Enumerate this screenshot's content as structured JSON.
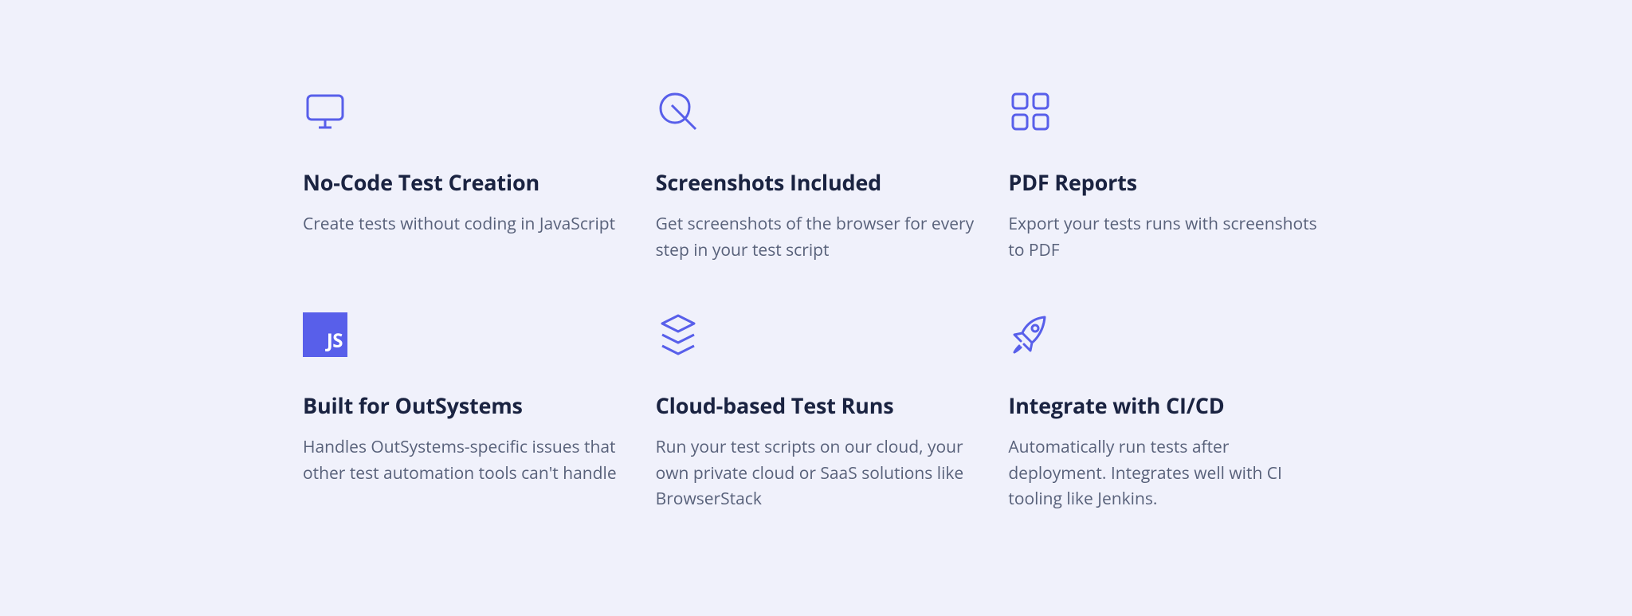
{
  "colors": {
    "icon": "#585fea",
    "heading": "#1a2341",
    "body": "#58617a",
    "background": "#f0f1fb"
  },
  "features": [
    {
      "icon": "monitor",
      "title": "No-Code Test Creation",
      "desc": "Create tests without coding in JavaScript"
    },
    {
      "icon": "leaf",
      "title": "Screenshots Included",
      "desc": "Get screenshots of the browser for every step in your test script"
    },
    {
      "icon": "grid",
      "title": "PDF Reports",
      "desc": "Export your tests runs with screenshots to PDF"
    },
    {
      "icon": "js",
      "title": "Built for OutSystems",
      "desc": "Handles OutSystems-specific issues that other test automation tools can't handle"
    },
    {
      "icon": "stack",
      "title": "Cloud-based Test Runs",
      "desc": "Run your test scripts on our cloud, your own private cloud or SaaS solutions like BrowserStack"
    },
    {
      "icon": "rocket",
      "title": "Integrate with CI/CD",
      "desc": "Automatically run tests after deployment. Integrates well with CI tooling like Jenkins."
    }
  ]
}
